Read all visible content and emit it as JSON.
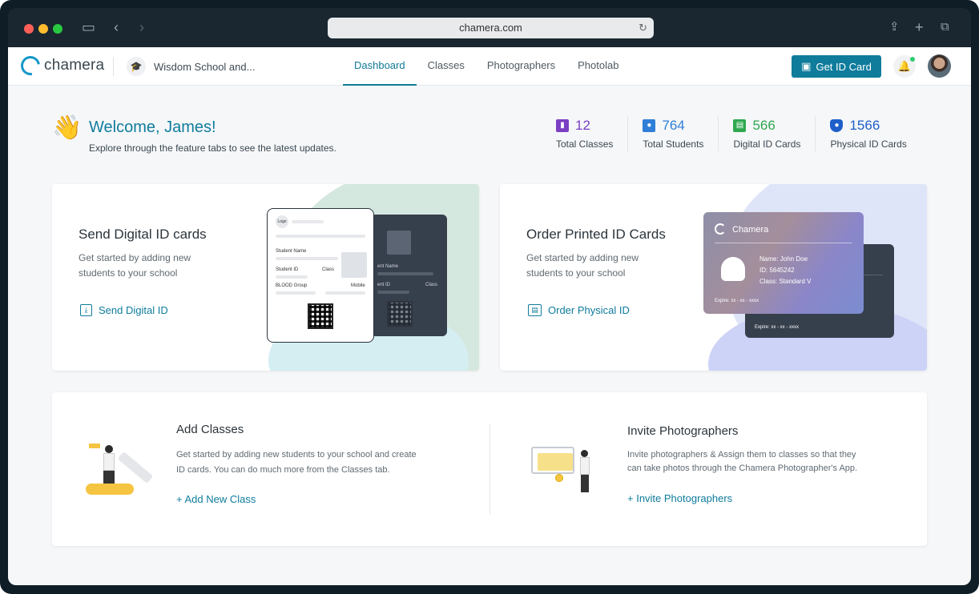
{
  "browser": {
    "url": "chamera.com"
  },
  "nav": {
    "logo_text": "chamera",
    "school_name": "Wisdom School and...",
    "tabs": [
      {
        "label": "Dashboard",
        "active": true
      },
      {
        "label": "Classes",
        "active": false
      },
      {
        "label": "Photographers",
        "active": false
      },
      {
        "label": "Photolab",
        "active": false
      }
    ],
    "get_id_label": "Get ID Card"
  },
  "welcome": {
    "title": "Welcome, James!",
    "subtitle": "Explore through the feature tabs to see the latest updates."
  },
  "stats": [
    {
      "value": "12",
      "label": "Total Classes",
      "color": "#7b3fc4",
      "icon": "book-icon"
    },
    {
      "value": "764",
      "label": "Total Students",
      "color": "#2f7fd8",
      "icon": "student-icon"
    },
    {
      "value": "566",
      "label": "Digital ID Cards",
      "color": "#2fa84f",
      "icon": "id-card-icon"
    },
    {
      "value": "1566",
      "label": "Physical ID Cards",
      "color": "#1e5fc9",
      "icon": "badge-icon"
    }
  ],
  "digital_card": {
    "title": "Send Digital ID cards",
    "desc_line1": "Get started by adding new",
    "desc_line2": "students to your school",
    "link": "Send Digital ID",
    "illus": {
      "logo": "Logo",
      "student_name": "Student Name",
      "student_id": "Student ID",
      "class": "Class",
      "blood_group": "BLOOD Group",
      "mobile": "Mobile",
      "back_name": "ent Name",
      "back_id": "ent ID",
      "back_class": "Class"
    }
  },
  "printed_card": {
    "title": "Order Printed ID Cards",
    "desc_line1": "Get started by adding new",
    "desc_line2": "students to your school",
    "link": "Order Physical ID",
    "illus": {
      "brand": "Chamera",
      "name": "Name: John Doe",
      "id": "ID: 5645242",
      "class": "Class: Standard V",
      "expire": "Expire: xx - xx - xxxx",
      "expire_back": "Expire: xx - xx - xxxx"
    }
  },
  "add_classes": {
    "title": "Add Classes",
    "desc_line1": "Get started by adding new students to your school and create",
    "desc_line2": "ID cards. You can do much more from the Classes tab.",
    "link": "+ Add New Class"
  },
  "invite": {
    "title": "Invite Photographers",
    "desc_line1": "Invite photographers & Assign them to classes so that they",
    "desc_line2": "can take photos through the Chamera Photographer's App.",
    "link": "+ Invite Photographers"
  }
}
